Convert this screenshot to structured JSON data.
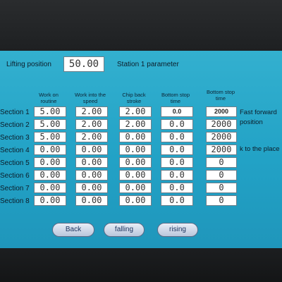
{
  "lifting": {
    "label": "Lifting position",
    "value": "50.00"
  },
  "station_title": "Station 1 parameter",
  "columns": [
    "Work on routine",
    "Work into the speed",
    "Chip back stroke",
    "Bottom stop time",
    "Bottom stop time"
  ],
  "rows": [
    {
      "label": "Section 1",
      "values": [
        "5.00",
        "2.00",
        "2.00",
        "0.0",
        "2000"
      ]
    },
    {
      "label": "Section 2",
      "values": [
        "5.00",
        "2.00",
        "2.00",
        "0.0",
        "2000"
      ]
    },
    {
      "label": "Section 3",
      "values": [
        "5.00",
        "2.00",
        "0.00",
        "0.0",
        "2000"
      ]
    },
    {
      "label": "Section 4",
      "values": [
        "0.00",
        "0.00",
        "0.00",
        "0.0",
        "2000"
      ]
    },
    {
      "label": "Section 5",
      "values": [
        "0.00",
        "0.00",
        "0.00",
        "0.0",
        "0"
      ]
    },
    {
      "label": "Section 6",
      "values": [
        "0.00",
        "0.00",
        "0.00",
        "0.0",
        "0"
      ]
    },
    {
      "label": "Section 7",
      "values": [
        "0.00",
        "0.00",
        "0.00",
        "0.0",
        "0"
      ]
    },
    {
      "label": "Section 8",
      "values": [
        "0.00",
        "0.00",
        "0.00",
        "0.0",
        "0"
      ]
    }
  ],
  "side_notes": {
    "fast_forward": "Fast forward",
    "position": "position",
    "to_place": "k to the place"
  },
  "buttons": {
    "back": "Back",
    "falling": "falling",
    "rising": "rising"
  },
  "colors": {
    "screen": "#22a2c6",
    "button": "#c9d4e8"
  }
}
